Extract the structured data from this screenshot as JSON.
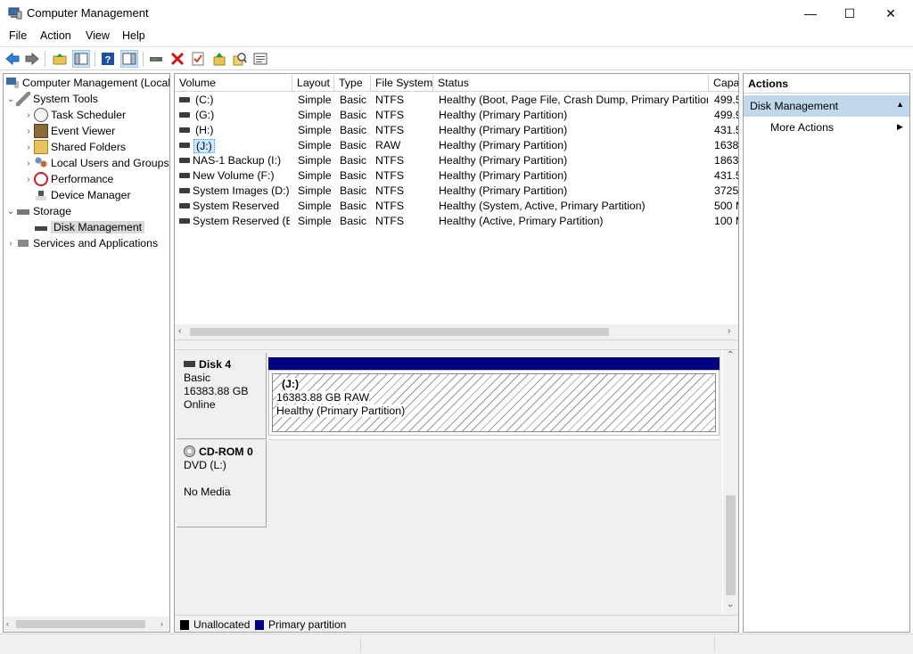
{
  "window": {
    "title": "Computer Management",
    "minimize_glyph": "—",
    "maximize_glyph": "☐",
    "close_glyph": "✕"
  },
  "menu": [
    "File",
    "Action",
    "View",
    "Help"
  ],
  "toolbar": [
    "back-icon",
    "forward-icon",
    "up-folder-icon",
    "show-hide-tree-icon",
    "help-icon",
    "show-hide-action-pane-icon",
    "connect-icon",
    "delete-icon",
    "checklist-icon",
    "import-icon",
    "search-icon",
    "properties-icon"
  ],
  "tree": {
    "root": "Computer Management (Local",
    "system_tools": "System Tools",
    "task_scheduler": "Task Scheduler",
    "event_viewer": "Event Viewer",
    "shared_folders": "Shared Folders",
    "local_users": "Local Users and Groups",
    "performance": "Performance",
    "device_manager": "Device Manager",
    "storage": "Storage",
    "disk_management": "Disk Management",
    "services": "Services and Applications"
  },
  "volumes": {
    "columns": [
      "Volume",
      "Layout",
      "Type",
      "File System",
      "Status",
      "Capa"
    ],
    "rows": [
      {
        "volume": "(C:)",
        "layout": "Simple",
        "type": "Basic",
        "fs": "NTFS",
        "status": "Healthy (Boot, Page File, Crash Dump, Primary Partition)",
        "capacity": "499.5"
      },
      {
        "volume": "(G:)",
        "layout": "Simple",
        "type": "Basic",
        "fs": "NTFS",
        "status": "Healthy (Primary Partition)",
        "capacity": "499.9"
      },
      {
        "volume": "(H:)",
        "layout": "Simple",
        "type": "Basic",
        "fs": "NTFS",
        "status": "Healthy (Primary Partition)",
        "capacity": "431.5"
      },
      {
        "volume": "(J:)",
        "layout": "Simple",
        "type": "Basic",
        "fs": "RAW",
        "status": "Healthy (Primary Partition)",
        "capacity": "1638"
      },
      {
        "volume": "NAS-1 Backup (I:)",
        "layout": "Simple",
        "type": "Basic",
        "fs": "NTFS",
        "status": "Healthy (Primary Partition)",
        "capacity": "1863."
      },
      {
        "volume": "New Volume (F:)",
        "layout": "Simple",
        "type": "Basic",
        "fs": "NTFS",
        "status": "Healthy (Primary Partition)",
        "capacity": "431.5"
      },
      {
        "volume": "System Images (D:)",
        "layout": "Simple",
        "type": "Basic",
        "fs": "NTFS",
        "status": "Healthy (Primary Partition)",
        "capacity": "3725."
      },
      {
        "volume": "System Reserved",
        "layout": "Simple",
        "type": "Basic",
        "fs": "NTFS",
        "status": "Healthy (System, Active, Primary Partition)",
        "capacity": "500 M"
      },
      {
        "volume": "System Reserved (E:)",
        "layout": "Simple",
        "type": "Basic",
        "fs": "NTFS",
        "status": "Healthy (Active, Primary Partition)",
        "capacity": "100 M"
      }
    ]
  },
  "disks": {
    "disk4": {
      "name": "Disk 4",
      "type": "Basic",
      "size": "16383.88 GB",
      "state": "Online",
      "partition_label": "(J:)",
      "partition_size": "16383.88 GB RAW",
      "partition_status": "Healthy (Primary Partition)"
    },
    "cdrom0": {
      "name": "CD-ROM 0",
      "type": "DVD (L:)",
      "state": "No Media"
    }
  },
  "legend": {
    "unallocated": "Unallocated",
    "primary": "Primary partition",
    "unallocated_color": "#000000",
    "primary_color": "#000080"
  },
  "actions": {
    "title": "Actions",
    "section": "Disk Management",
    "more": "More Actions"
  }
}
